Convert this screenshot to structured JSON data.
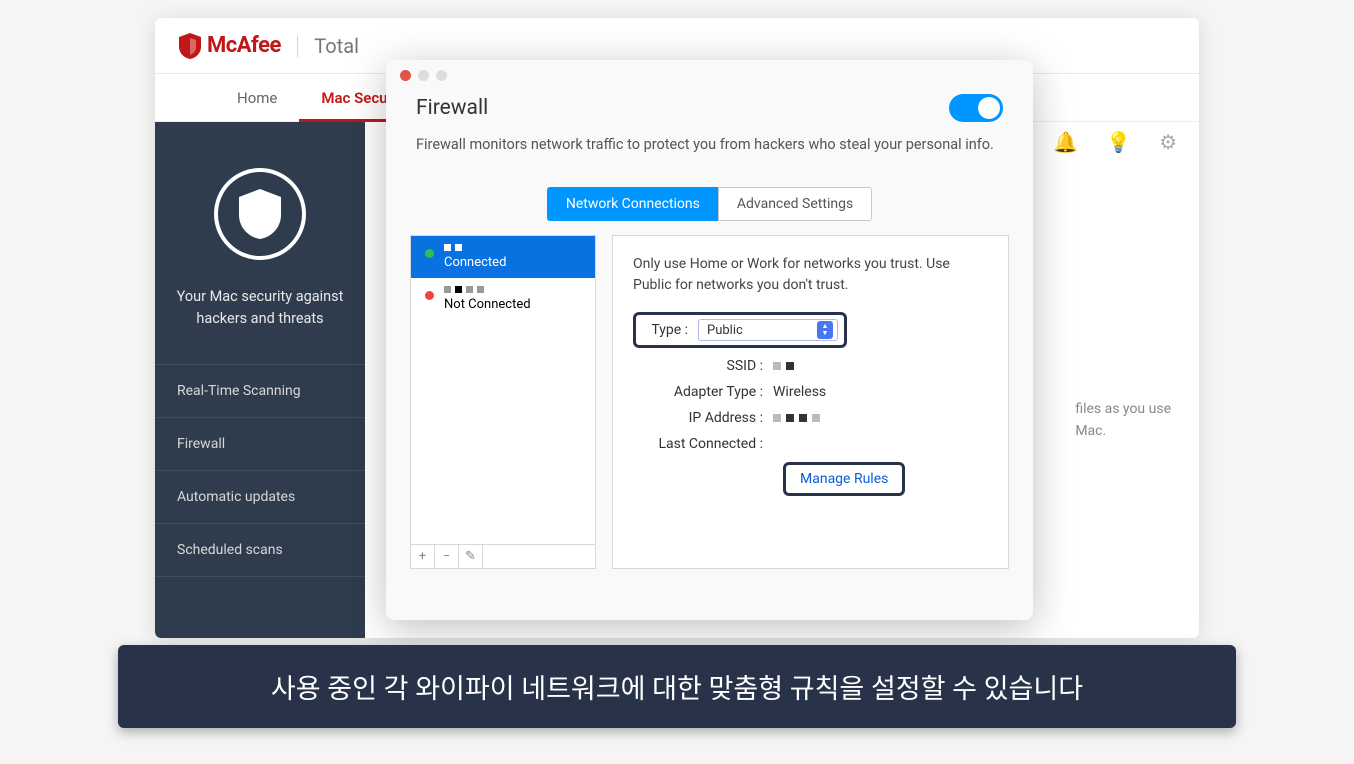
{
  "header": {
    "brand": "McAfee",
    "product": "Total"
  },
  "tabs": {
    "home": "Home",
    "mac_security": "Mac Security"
  },
  "dark_panel": {
    "status_line1": "Your Mac security against",
    "status_line2": "hackers and threats",
    "menu": {
      "rts": "Real-Time Scanning",
      "firewall": "Firewall",
      "updates": "Automatic updates",
      "scans": "Scheduled scans"
    }
  },
  "bg_text": {
    "line1": "files as you use",
    "line2": "Mac."
  },
  "dialog": {
    "title": "Firewall",
    "subtitle": "Firewall monitors network traffic to protect you from hackers who steal your personal info.",
    "inner_tabs": {
      "network": "Network Connections",
      "advanced": "Advanced Settings"
    },
    "connections": {
      "connected": "Connected",
      "not_connected": "Not Connected"
    },
    "details": {
      "description": "Only use Home or Work for networks you trust. Use Public for networks you don't trust.",
      "labels": {
        "type": "Type :",
        "ssid": "SSID :",
        "adapter": "Adapter Type :",
        "ip": "IP Address :",
        "last": "Last Connected :"
      },
      "type_value": "Public",
      "adapter_value": "Wireless",
      "manage_rules": "Manage Rules"
    }
  },
  "caption": "사용 중인 각 와이파이 네트워크에 대한 맞춤형 규칙을 설정할 수 있습니다"
}
